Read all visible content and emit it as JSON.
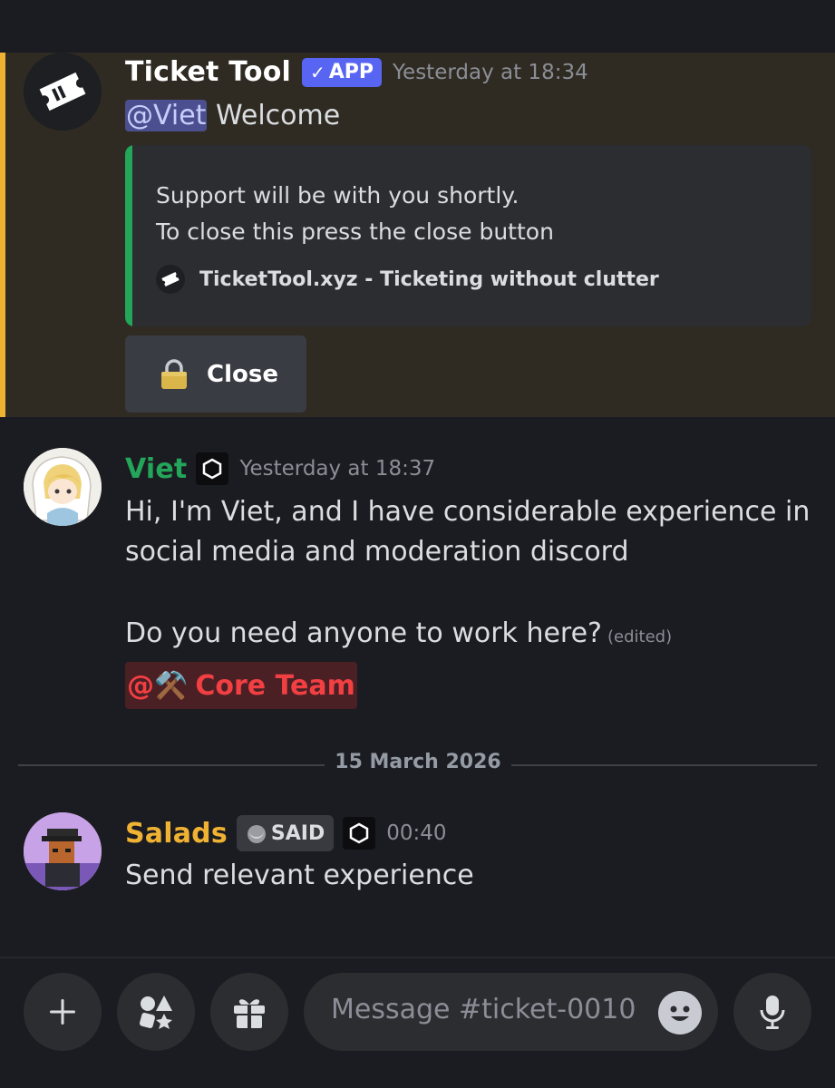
{
  "messages": [
    {
      "author": "Ticket Tool",
      "author_color": "#ffffff",
      "badge": {
        "check": "✓",
        "label": "APP"
      },
      "timestamp": "Yesterday at 18:34",
      "mention": "@Viet",
      "text": "Welcome",
      "highlight_color": "#f0b232",
      "embed": {
        "line1": "Support will be with you shortly.",
        "line2": "To close this press the close button",
        "footer": "TicketTool.xyz - Ticketing without clutter",
        "bar_color": "#23a55a"
      },
      "button": {
        "icon": "lock-icon",
        "label": "Close"
      }
    },
    {
      "author": "Viet",
      "author_color": "#23a55a",
      "tag_icon": "hexagon-icon",
      "timestamp": "Yesterday at 18:37",
      "line1": "Hi, I'm Viet, and I have considerable experience in",
      "line2": "social media and moderation discord",
      "line3": "Do you need anyone to work here?",
      "edited": "(edited)",
      "role_mention": {
        "at": "@",
        "emoji": "⚒️",
        "name": "Core Team",
        "color": "#f23f42"
      }
    },
    {
      "author": "Salads",
      "author_color": "#f0b232",
      "guild_tag": "SAID",
      "tag_icon": "hexagon-icon",
      "timestamp": "00:40",
      "text": "Send relevant experience"
    }
  ],
  "date_divider": "15 March 2026",
  "composer": {
    "placeholder": "Message #ticket-0010",
    "buttons": [
      "plus-icon",
      "apps-icon",
      "gift-icon",
      "emoji-icon",
      "microphone-icon"
    ]
  }
}
